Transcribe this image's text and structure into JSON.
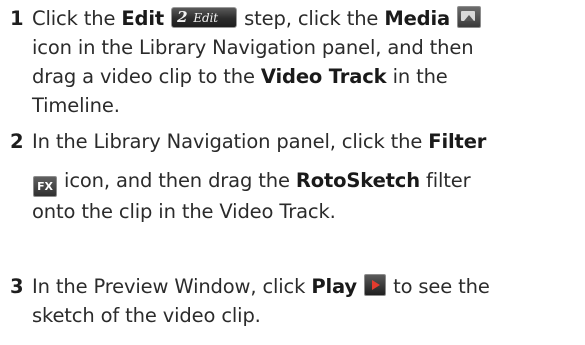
{
  "steps": [
    {
      "number": "1",
      "lines": [
        [
          "Click the ",
          "Edit",
          " step, click the ",
          "Media"
        ],
        [
          "icon in the Library Navigation panel, and then"
        ],
        [
          "drag a video clip to the ",
          "Video Track",
          " in the"
        ],
        [
          "Timeline."
        ]
      ],
      "edit_icon": {
        "num": "2",
        "label": "Edit"
      }
    },
    {
      "number": "2",
      "lines": [
        [
          "In the Library Navigation panel, click the ",
          "Filter"
        ],
        [
          " icon, and then drag the ",
          "RotoSketch",
          " filter"
        ],
        [
          "onto the clip in the Video Track."
        ]
      ],
      "fx_icon": "FX"
    },
    {
      "number": "3",
      "lines": [
        [
          "In the Preview Window, click ",
          "Play",
          " to see the"
        ],
        [
          "sketch of the video clip."
        ]
      ]
    }
  ],
  "icons": {
    "media": "media-icon",
    "filter": "fx-icon",
    "play": "play-icon",
    "edit_step": "edit-step-icon"
  }
}
